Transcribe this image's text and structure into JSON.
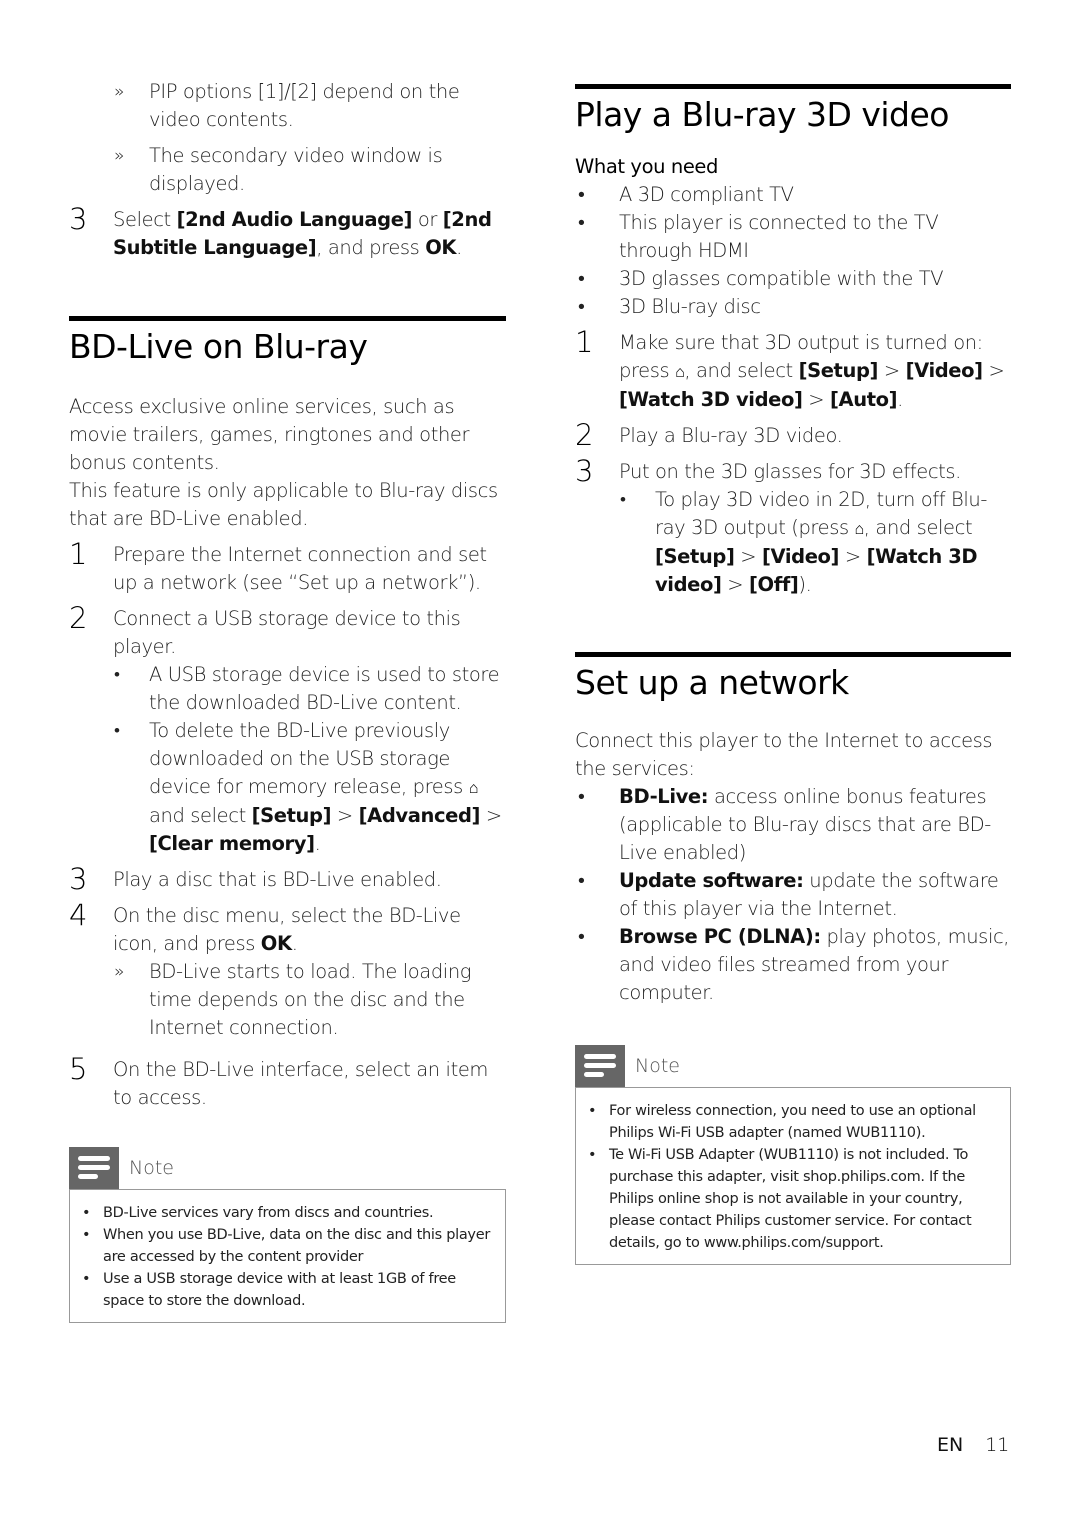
{
  "left": {
    "intro_subs": [
      {
        "marker": "»",
        "text": "PIP options [1]/[2] depend on the video contents."
      },
      {
        "marker": "»",
        "text": "The secondary video window is displayed."
      }
    ],
    "intro_step": {
      "num": "3",
      "pre": "Select ",
      "b1": "[2nd Audio Language]",
      "mid": " or ",
      "b2": "[2nd Subtitle Language]",
      "post": ", and press ",
      "b3": "OK",
      "end": "."
    },
    "bdlive": {
      "title": "BD-Live on Blu-ray",
      "para1": "Access exclusive online services, such as movie trailers, games, ringtones and other bonus contents.",
      "para2": "This feature is only applicable to Blu-ray discs that are BD-Live enabled.",
      "step1": {
        "num": "1",
        "text": "Prepare the Internet connection and set up a network (see “Set up a network”)."
      },
      "step2": {
        "num": "2",
        "text": "Connect a USB storage device to this player."
      },
      "step2_bullets": {
        "b1": "A USB storage device is used to store the downloaded BD-Live content.",
        "b2_pre": "To delete the BD-Live previously downloaded on the USB storage device for memory release, press ",
        "b2_mid": " and select ",
        "b2_setup": "[Setup]",
        "b2_sep1": " > ",
        "b2_adv": "[Advanced]",
        "b2_sep2": " > ",
        "b2_clear": "[Clear memory]",
        "b2_end": "."
      },
      "step3": {
        "num": "3",
        "text": "Play a disc that is BD-Live enabled."
      },
      "step4": {
        "num": "4",
        "pre": "On the disc menu, select the BD-Live icon, and press ",
        "b": "OK",
        "end": "."
      },
      "step4_sub": {
        "marker": "»",
        "text": "BD-Live starts to load. The loading time depends on the disc and the Internet connection."
      },
      "step5": {
        "num": "5",
        "text": "On the BD-Live interface, select an item to access."
      }
    },
    "note": {
      "label": "Note",
      "items": [
        "BD-Live services vary from discs and countries.",
        "When you use BD-Live, data on the disc and this player are accessed by the content provider",
        "Use a USB storage device with at least 1GB of free space to store the download."
      ]
    }
  },
  "right": {
    "play3d": {
      "title": "Play a Blu-ray 3D video",
      "need_label": "What you need",
      "needs": [
        "A 3D compliant TV",
        "This player is connected to the TV through HDMI",
        "3D glasses compatible with the TV",
        "3D Blu-ray disc"
      ],
      "step1": {
        "num": "1",
        "pre": "Make sure that 3D output is turned on: press ",
        "mid": ", and select ",
        "setup": "[Setup]",
        "sep1": " > ",
        "video": "[Video]",
        "sep2": " >",
        "watch": "[Watch 3D video]",
        "sep3": " > ",
        "auto": "[Auto]",
        "end": "."
      },
      "step2": {
        "num": "2",
        "text": "Play a Blu-ray 3D video."
      },
      "step3": {
        "num": "3",
        "text": "Put on the 3D glasses for 3D effects."
      },
      "step3_bullet": {
        "pre": "To play 3D video in 2D, turn off Blu-ray 3D output (press ",
        "mid": ", and select ",
        "setup": "[Setup]",
        "sep1": " > ",
        "video": "[Video]",
        "sep2": " > ",
        "watch": "[Watch 3D video]",
        "sep3": " > ",
        "off": "[Off]",
        "end": ")."
      }
    },
    "network": {
      "title": "Set up a network",
      "intro": "Connect this player to the Internet to access the services:",
      "bullets": [
        {
          "b": "BD-Live:",
          "text": " access online bonus features (applicable to Blu-ray discs that are BD-Live enabled)"
        },
        {
          "b": "Update software:",
          "text": " update the software of this player via the Internet."
        },
        {
          "b": "Browse PC (DLNA):",
          "text": " play photos, music, and video files streamed from your computer."
        }
      ]
    },
    "note": {
      "label": "Note",
      "items": [
        "For wireless connection, you need to use an optional Philips Wi-Fi USB adapter (named WUB1110).",
        "Te Wi-Fi USB Adapter (WUB1110) is not included. To purchase this adapter, visit shop.philips.com. If the Philips online shop is not available in your country, please contact Philips customer service. For contact details, go to www.philips.com/support."
      ]
    }
  },
  "footer": {
    "lang": "EN",
    "page": "11"
  },
  "icons": {
    "home": "⌂",
    "bullet": "•"
  }
}
